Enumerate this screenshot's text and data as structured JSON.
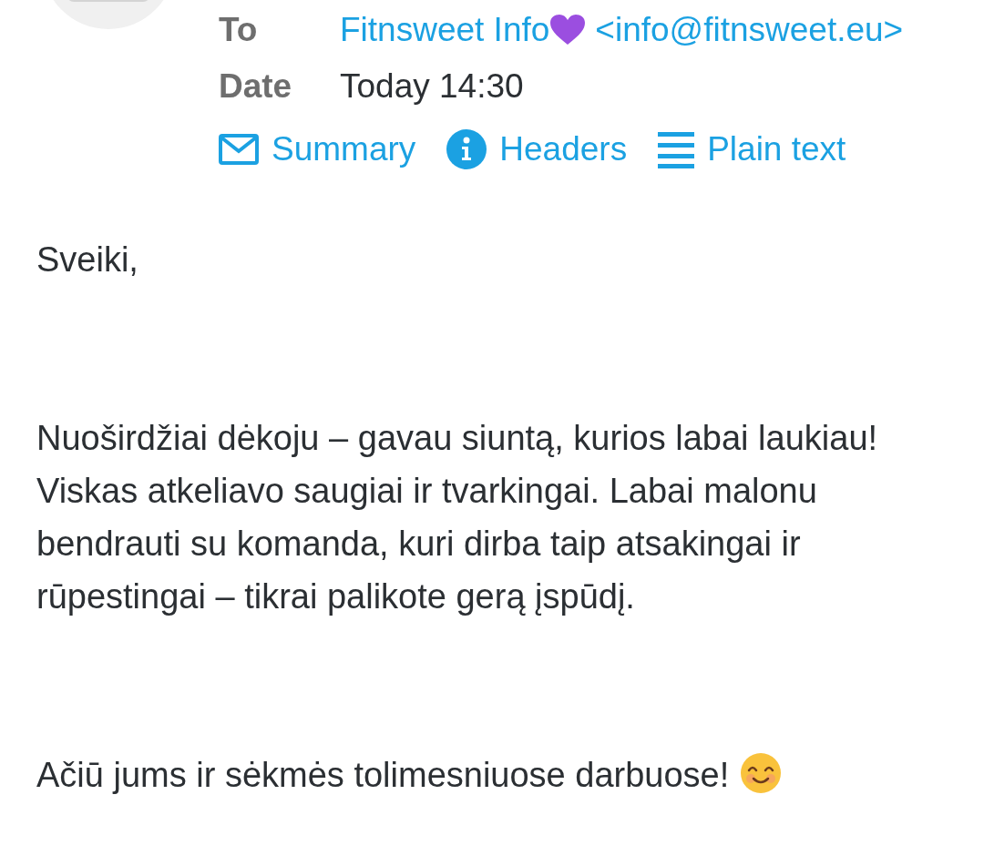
{
  "header": {
    "fields": [
      {
        "label": "To",
        "value": "Fitnsweet Info",
        "address": "<info@fitnsweet.eu>",
        "kind": "contact"
      },
      {
        "label": "Date",
        "value": "Today 14:30",
        "kind": "plain"
      }
    ],
    "views": [
      {
        "label": "Summary",
        "kind": "envelope"
      },
      {
        "label": "Headers",
        "kind": "info"
      },
      {
        "label": "Plain text",
        "kind": "lines"
      }
    ]
  },
  "body": {
    "paragraphs": [
      {
        "text": "Sveiki,"
      },
      {
        "text": "Nuoširdžiai dėkoju – gavau siuntą, kurios labai laukiau! Viskas atkeliavo saugiai ir tvarkingai. Labai malonu bendrauti su komanda, kuri dirba taip atsakingai ir rūpestingai – tikrai palikote gerą įspūdį."
      },
      {
        "text": "Ačiū jums ir sėkmės tolimesniuose darbuose!",
        "emoji": true
      }
    ]
  }
}
